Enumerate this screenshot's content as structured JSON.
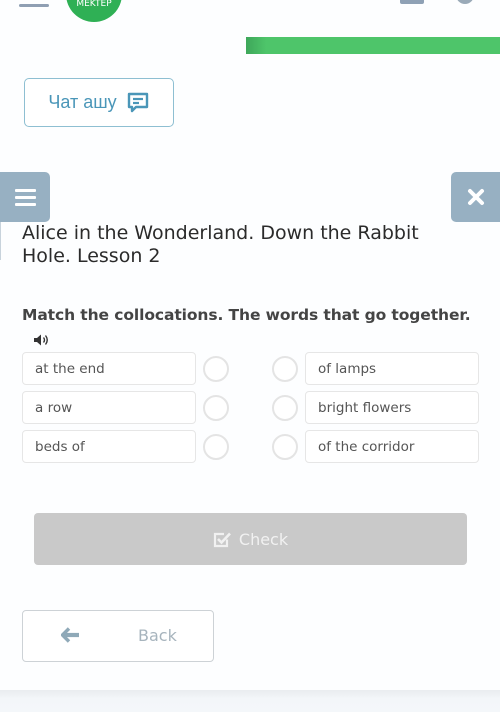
{
  "header": {
    "logo_text": "MEKTEP",
    "progress_percent": 100,
    "brand_color": "#2fb055",
    "progress_color": "#4ec56a"
  },
  "chat": {
    "label": "Чат ашу",
    "icon": "chat-bubble-icon",
    "accent_color": "#4a96b8"
  },
  "nav": {
    "menu_icon": "hamburger-icon",
    "close_icon": "close-icon",
    "button_color": "#97b0c2"
  },
  "lesson": {
    "title": "Alice in the Wonderland. Down the Rabbit Hole. Lesson 2"
  },
  "task": {
    "instruction": "Match the collocations. The words that go together.",
    "audio_icon": "speaker-icon",
    "left_items": [
      {
        "label": "at the end"
      },
      {
        "label": "a row"
      },
      {
        "label": "beds of"
      }
    ],
    "right_items": [
      {
        "label": "of lamps"
      },
      {
        "label": "bright flowers"
      },
      {
        "label": "of the corridor"
      }
    ]
  },
  "actions": {
    "check_label": "Check",
    "check_icon": "checkbox-check-icon",
    "back_label": "Back",
    "back_icon": "arrow-left-icon"
  }
}
